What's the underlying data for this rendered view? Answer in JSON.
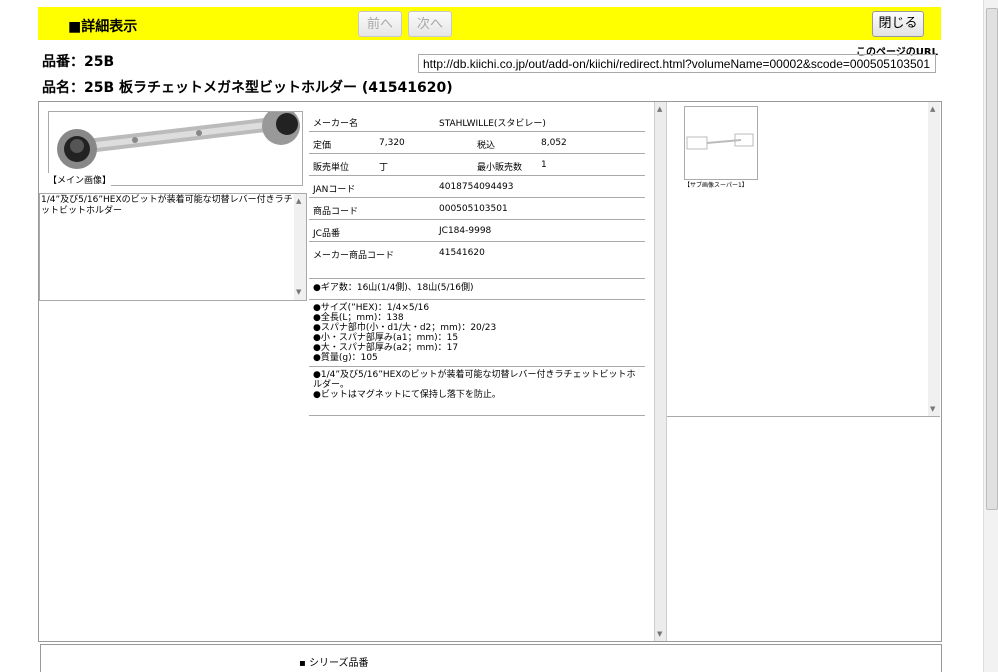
{
  "header": {
    "title": "■詳細表示",
    "prev_label": "前へ",
    "next_label": "次へ",
    "close_label": "閉じる"
  },
  "product": {
    "hinban": "品番：25B",
    "hinmei": "品名：25B 板ラチェットメガネ型ビットホルダー (41541620)"
  },
  "url": {
    "label": "このページのURL",
    "value": "http://db.kiichi.co.jp/out/add-on/kiichi/redirect.html?volumeName=00002&scode=000505103501"
  },
  "main_image": {
    "caption": "【メイン画像】"
  },
  "description": "1/4”及び5/16”HEXのビットが装着可能な切替レバー付きラチェットビットホルダー",
  "spec": {
    "maker_label": "メーカー名",
    "maker": "STAHLWILLE(スタビレー)",
    "price_label": "定価",
    "price": "7,320",
    "taxin_label": "税込",
    "taxin": "8,052",
    "unit_label": "販売単位",
    "unit": "丁",
    "min_label": "最小販売数",
    "min": "1",
    "jan_label": "JANコード",
    "jan": "4018754094493",
    "code_label": "商品コード",
    "code": "000505103501",
    "jc_label": "JC品番",
    "jc": "JC184-9998",
    "mcode_label": "メーカー商品コード",
    "mcode": "41541620"
  },
  "notes": {
    "gear": "●ギア数：16山(1/4側)、18山(5/16側)",
    "dims": [
      "●サイズ(”HEX)：1/4×5/16",
      "●全長(L；mm)：138",
      "●スパナ部巾(小・d1/大・d2；mm)：20/23",
      "●小・スパナ部厚み(a1；mm)：15",
      "●大・スパナ部厚み(a2；mm)：17",
      "●質量(g)：105"
    ],
    "features": [
      "●1/4”及び5/16”HEXのビットが装着可能な切替レバー付きラチェットビットホルダー。",
      "●ビットはマグネットにて保持し落下を防止。"
    ]
  },
  "sub_image": {
    "caption": "【サブ画像スーパー1】"
  },
  "bottom": {
    "series_label": "シリーズ品番"
  }
}
